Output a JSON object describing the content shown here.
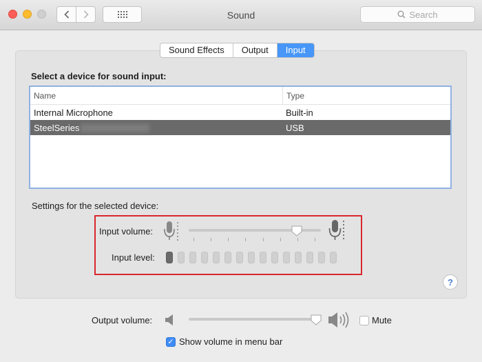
{
  "window": {
    "title": "Sound"
  },
  "search": {
    "placeholder": "Search"
  },
  "tabs": [
    {
      "label": "Sound Effects",
      "active": false
    },
    {
      "label": "Output",
      "active": false
    },
    {
      "label": "Input",
      "active": true
    }
  ],
  "input_panel": {
    "heading": "Select a device for sound input:",
    "columns": {
      "name": "Name",
      "type": "Type"
    },
    "rows": [
      {
        "name": "Internal Microphone",
        "type": "Built-in",
        "selected": false
      },
      {
        "name": "SteelSeries",
        "type": "USB",
        "selected": true
      }
    ],
    "settings_label": "Settings for the selected device:",
    "input_volume_label": "Input volume:",
    "input_volume_value": 0.82,
    "input_level_label": "Input level:",
    "input_level_segments": 15,
    "input_level_active": 1,
    "help": "?"
  },
  "output": {
    "volume_label": "Output volume:",
    "volume_value": 1.0,
    "mute_label": "Mute",
    "mute_checked": false,
    "show_in_menu_label": "Show volume in menu bar",
    "show_in_menu_checked": true
  },
  "colors": {
    "accent": "#4796f8",
    "highlight_box": "#d9262b",
    "selected_row": "#6a6a6a"
  }
}
